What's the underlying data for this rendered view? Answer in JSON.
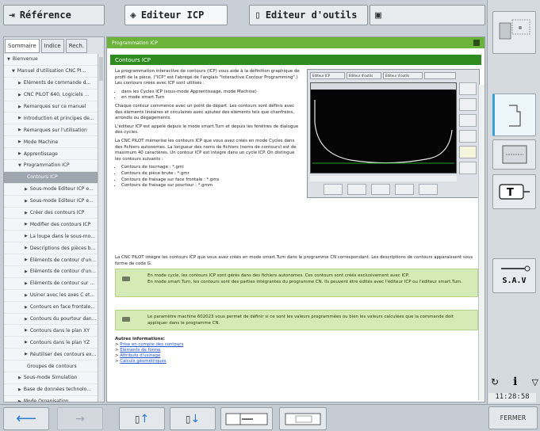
{
  "tabs": [
    {
      "label": "Référence"
    },
    {
      "label": "Editeur ICP"
    },
    {
      "label": "Editeur d'outils"
    },
    {
      "label": ""
    }
  ],
  "sidebar": {
    "tabs": [
      "Sommaire",
      "Indice",
      "Rech."
    ],
    "items": [
      {
        "label": "Bienvenue",
        "level": 0,
        "arrow": "▼"
      },
      {
        "label": "Manuel d'utilisation CNC PI...",
        "level": 1,
        "arrow": "▼"
      },
      {
        "label": "Eléments de commande d...",
        "level": 2,
        "arrow": "▶"
      },
      {
        "label": "CNC PILOT 640, Logiciels ...",
        "level": 2,
        "arrow": "▶"
      },
      {
        "label": "Remarques sur ce manuel",
        "level": 2,
        "arrow": "▶"
      },
      {
        "label": "Introduction et principes de...",
        "level": 2,
        "arrow": "▶"
      },
      {
        "label": "Remarques sur l'utilisation",
        "level": 2,
        "arrow": "▶"
      },
      {
        "label": "Mode Machine",
        "level": 2,
        "arrow": "▶"
      },
      {
        "label": "Apprentissage",
        "level": 2,
        "arrow": "▶"
      },
      {
        "label": "Programmation ICP",
        "level": 2,
        "arrow": "▼"
      },
      {
        "label": "Contours ICP",
        "level": 3,
        "arrow": "",
        "selected": true
      },
      {
        "label": "Sous-mode Editeur ICP e...",
        "level": 3,
        "arrow": "▶"
      },
      {
        "label": "Sous-mode Editeur ICP e...",
        "level": 3,
        "arrow": "▶"
      },
      {
        "label": "Créer des contours ICP",
        "level": 3,
        "arrow": "▶"
      },
      {
        "label": "Modifier des contours ICP",
        "level": 3,
        "arrow": "▶"
      },
      {
        "label": "La loupe dans le sous-mo...",
        "level": 3,
        "arrow": "▶"
      },
      {
        "label": "Descriptions des pièces b...",
        "level": 3,
        "arrow": "▶"
      },
      {
        "label": "Eléments de contour d'un...",
        "level": 3,
        "arrow": "▶"
      },
      {
        "label": "Eléments de contour d'un...",
        "level": 3,
        "arrow": "▶"
      },
      {
        "label": "Eléments de contour sur ...",
        "level": 3,
        "arrow": "▶"
      },
      {
        "label": "Usiner avec les axes C et...",
        "level": 3,
        "arrow": "▶"
      },
      {
        "label": "Contours en face frontale...",
        "level": 3,
        "arrow": "▶"
      },
      {
        "label": "Contours du pourtour dan...",
        "level": 3,
        "arrow": "▶"
      },
      {
        "label": "Contours dans le plan XY",
        "level": 3,
        "arrow": "▶"
      },
      {
        "label": "Contours dans le plan YZ",
        "level": 3,
        "arrow": "▶"
      },
      {
        "label": "Réutiliser des contours ex...",
        "level": 3,
        "arrow": "▶"
      },
      {
        "label": "Groupes de contours",
        "level": 3,
        "arrow": ""
      },
      {
        "label": "Sous-mode Simulation",
        "level": 2,
        "arrow": "▶"
      },
      {
        "label": "Base de données technolo...",
        "level": 2,
        "arrow": "▶"
      },
      {
        "label": "Mode Organisation",
        "level": 2,
        "arrow": "▶"
      }
    ]
  },
  "content": {
    "breadcrumb": "Programmation ICP",
    "badge": "",
    "title": "Contours ICP",
    "paragraphs": [
      "La programmation interactive de contours (ICP) vous aide à la définition graphique de profil de la pièce. (\"ICP\" est l'abrégé de l'anglais \"Interactive Contour Programming\".) Les contours créés avec ICP sont utilisés :"
    ],
    "uses": [
      "dans les Cycles ICP (sous-mode Apprentissage, mode Machine)",
      "en mode smart.Turn"
    ],
    "paragraphs2": [
      "Chaque contour commence avec un point de départ. Les contours sont définis avec des éléments linéaires et circulaires avec ajoutez des éléments tels que chanfreins, arrondis ou dégagements.",
      "L'éditeur ICP est appelé depuis le mode smart.Turn et depuis les fenêtres de dialogue des cycles.",
      "La CNC PILOT mémorise les contours ICP que vous avez créés en mode Cycles dans des fichiers autonomes. La longueur des noms de fichiers (noms de contours) est de maximum 40 caractères. Un contour ICP est intégré dans un cycle ICP. On distingue les contours suivants :"
    ],
    "contours": [
      "Contours de tournage : *.gmi",
      "Contours de pièce brute : *.gmr",
      "Contours de fraisage sur face frontale : *.gms",
      "Contours de fraisage sur pourtour : *.gmm"
    ],
    "full_paragraph": "La CNC PILOT intègre les contours ICP que vous avez créés en mode smart.Turn dans le programme CN correspondant. Les descriptions de contours apparaissent sous forme de code G.",
    "note1": [
      "En mode cycle, les contours ICP sont gérés dans des fichiers autonomes. Ces contours sont créés exclusivement avec ICP.",
      "En mode smart.Turn, les contours sont des parties intégrantes du programme CN. Ils peuvent être édités avec l'éditeur ICP ou l'éditeur smart.Turn."
    ],
    "note2": "Le paramètre machine 602023 vous permet de définir si ce sont les valeurs programmées ou bien les valeurs calculées que la commande doit appliquer dans le programme CN.",
    "infos_title": "Autres informations:",
    "infos_links": [
      "Prise en compte des contours",
      "Eléments de forme",
      "Attributs d'usinage",
      "Calculs géométriques"
    ],
    "thumb": {
      "tabs": [
        "Editeur ICP",
        "Editeur d'outils",
        "Editeur d'outils",
        ""
      ],
      "window_title": "",
      "status": "",
      "buttons": [
        "",
        "",
        "",
        "",
        ""
      ],
      "right_labels": [
        "",
        ""
      ]
    }
  },
  "right_softkeys": [
    {
      "name": "zoom-view",
      "selected": false
    },
    {
      "name": "contour-thin",
      "selected": true
    },
    {
      "name": "cylinder",
      "selected": false
    },
    {
      "name": "tool-t",
      "selected": false
    },
    {
      "name": "sav",
      "label": "S.A.V",
      "selected": false
    }
  ],
  "clock": "11:28:58",
  "bottom": {
    "fermer": "FERMER"
  }
}
